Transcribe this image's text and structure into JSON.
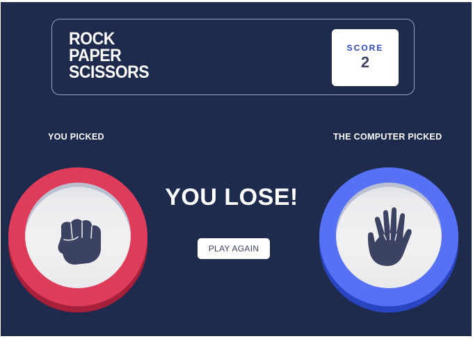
{
  "header": {
    "title_lines": [
      "ROCK",
      "PAPER",
      "SCISSORS"
    ],
    "score_label": "SCORE",
    "score_value": "2"
  },
  "player": {
    "label": "YOU PICKED",
    "pick": "rock",
    "icon": "rock-fist-icon"
  },
  "computer": {
    "label": "THE COMPUTER PICKED",
    "pick": "paper",
    "icon": "paper-hand-icon"
  },
  "result": {
    "message": "YOU LOSE!",
    "button_label": "PLAY AGAIN"
  },
  "colors": {
    "background": "#1f2b4d",
    "rock": "#de3c5a",
    "paper": "#5671f5",
    "icon": "#3b4262"
  }
}
